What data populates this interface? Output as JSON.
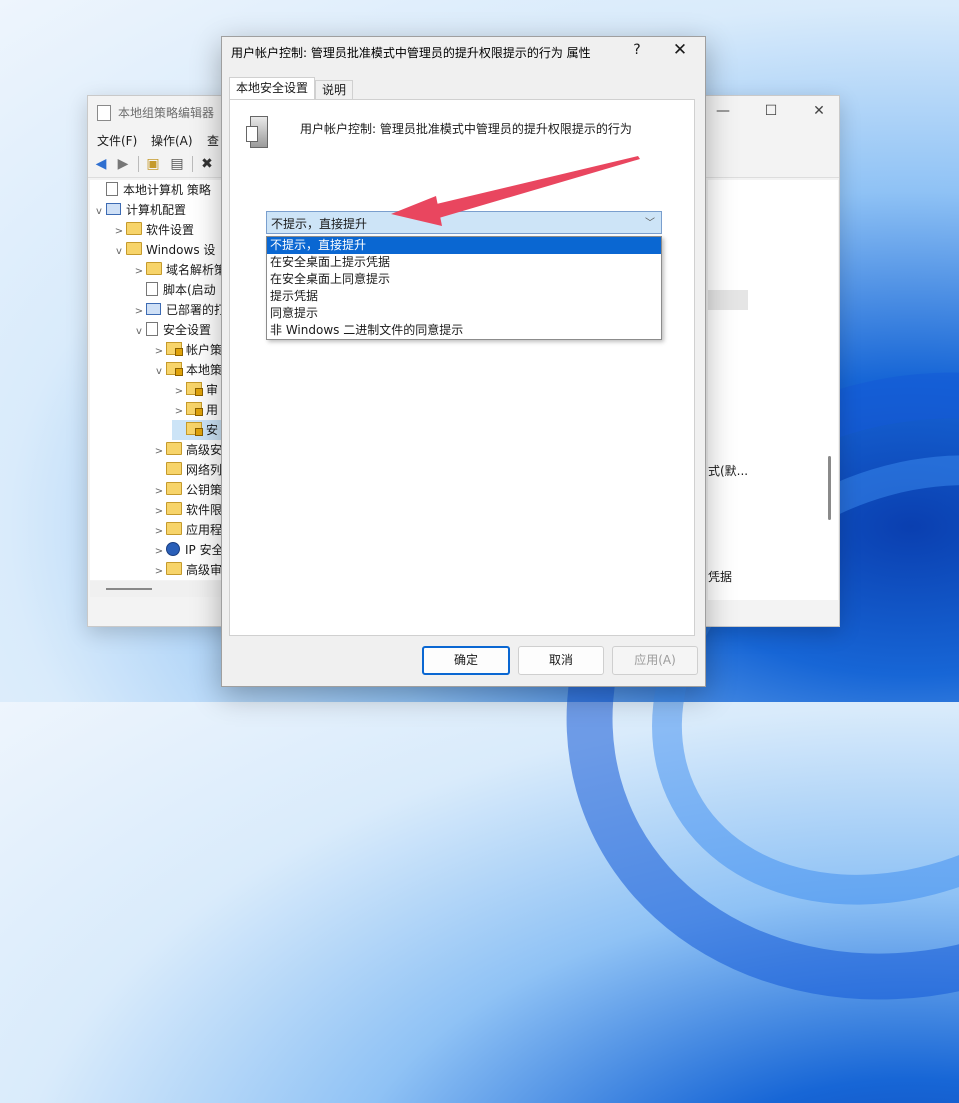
{
  "bg_window": {
    "title": "本地组策略编辑器",
    "menu": [
      "文件(F)",
      "操作(A)",
      "查"
    ],
    "tree": [
      {
        "label": "本地计算机 策略",
        "icon": "doc",
        "exp": ""
      },
      {
        "label": "计算机配置",
        "icon": "pc",
        "exp": "v"
      },
      {
        "label": "软件设置",
        "icon": "folder",
        "exp": ">"
      },
      {
        "label": "Windows 设",
        "icon": "folder",
        "exp": "v"
      },
      {
        "label": "域名解析策",
        "icon": "folder",
        "exp": ">"
      },
      {
        "label": "脚本(启动",
        "icon": "doc",
        "exp": ""
      },
      {
        "label": "已部署的打",
        "icon": "pc",
        "exp": ">"
      },
      {
        "label": "安全设置",
        "icon": "doc",
        "exp": "v"
      },
      {
        "label": "帐户策",
        "icon": "lock",
        "exp": ">"
      },
      {
        "label": "本地策",
        "icon": "lock",
        "exp": "v"
      },
      {
        "label": "审",
        "icon": "lock",
        "exp": ">"
      },
      {
        "label": "用",
        "icon": "lock",
        "exp": ">"
      },
      {
        "label": "安",
        "icon": "lock",
        "exp": ""
      },
      {
        "label": "高级安",
        "icon": "folder",
        "exp": ">"
      },
      {
        "label": "网络列",
        "icon": "folder",
        "exp": ""
      },
      {
        "label": "公钥策",
        "icon": "folder",
        "exp": ">"
      },
      {
        "label": "软件限",
        "icon": "folder",
        "exp": ">"
      },
      {
        "label": "应用程",
        "icon": "folder",
        "exp": ">"
      },
      {
        "label": "IP 安全",
        "icon": "globe",
        "exp": ">"
      },
      {
        "label": "高级审",
        "icon": "folder",
        "exp": ">"
      }
    ],
    "right_text_1": "式(默...",
    "right_text_2": "凭据"
  },
  "dialog": {
    "title": "用户帐户控制: 管理员批准模式中管理员的提升权限提示的行为 属性",
    "help_glyph": "?",
    "close_glyph": "✕",
    "tabs": [
      "本地安全设置",
      "说明"
    ],
    "policy_name": "用户帐户控制: 管理员批准模式中管理员的提升权限提示的行为",
    "selected_value": "不提示，直接提升",
    "options": [
      "不提示，直接提升",
      "在安全桌面上提示凭据",
      "在安全桌面上同意提示",
      "提示凭据",
      "同意提示",
      "非 Windows 二进制文件的同意提示"
    ],
    "highlighted_index": 0,
    "buttons": {
      "ok": "确定",
      "cancel": "取消",
      "apply": "应用(A)"
    }
  },
  "colors": {
    "accent": "#0a67d2",
    "arrow": "#e9465f"
  }
}
